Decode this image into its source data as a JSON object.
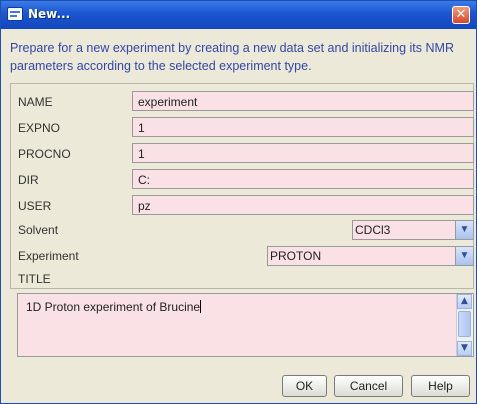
{
  "window": {
    "title": "New...",
    "close_glyph": "✕"
  },
  "description": "Prepare for a new experiment by creating a new data set and initializing its NMR parameters according to the selected experiment type.",
  "form": {
    "name_label": "NAME",
    "name_value": "experiment",
    "expno_label": "EXPNO",
    "expno_value": "1",
    "procno_label": "PROCNO",
    "procno_value": "1",
    "dir_label": "DIR",
    "dir_value": "C:",
    "user_label": "USER",
    "user_value": "pz",
    "solvent_label": "Solvent",
    "solvent_value": "CDCl3",
    "experiment_label": "Experiment",
    "experiment_value": "PROTON",
    "title_label": "TITLE",
    "title_value": "1D Proton experiment of Brucine"
  },
  "buttons": {
    "ok": "OK",
    "cancel": "Cancel",
    "help": "Help"
  },
  "icons": {
    "app": "dialog-window-icon",
    "close": "close-icon",
    "dropdown": "chevron-down-icon"
  },
  "colors": {
    "titlebar": "#1a55d0",
    "field_bg": "#f9e1e6",
    "description_text": "#3347a8",
    "close_button": "#d9482b"
  }
}
